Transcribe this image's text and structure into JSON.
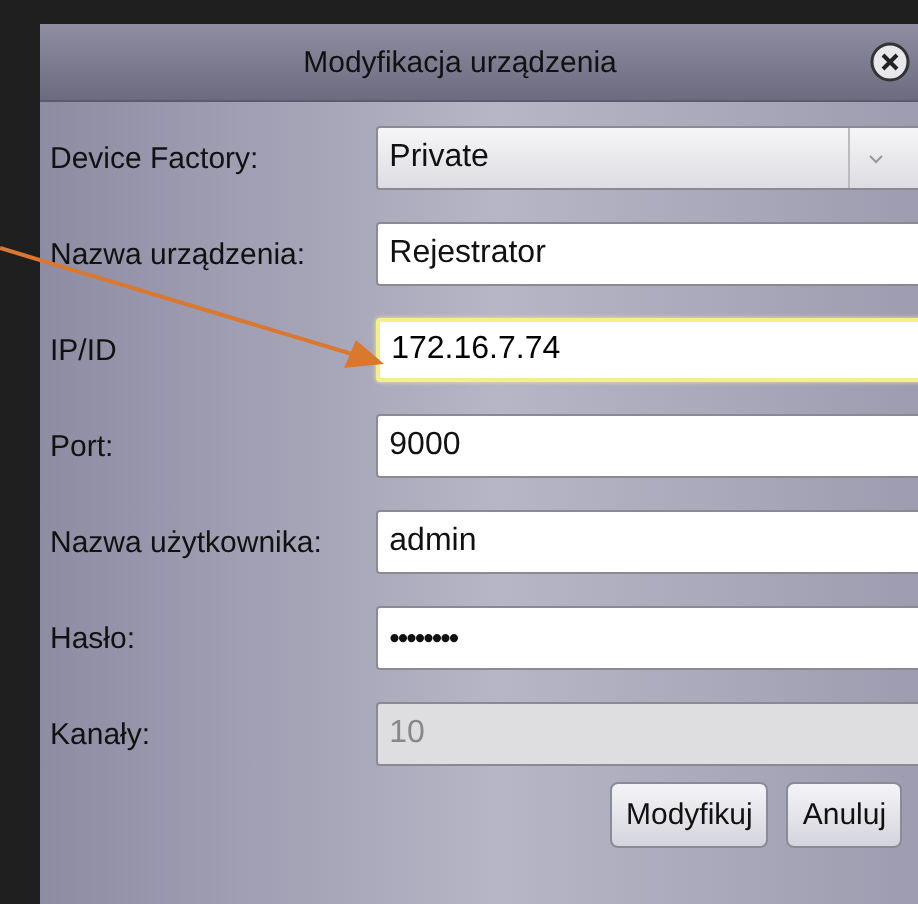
{
  "window": {
    "title": "Modyfikacja urządzenia"
  },
  "fields": [
    {
      "label": "Device Factory:",
      "kind": "dropdown",
      "value": "Private",
      "focused": false,
      "disabled": false
    },
    {
      "label": "Nazwa urządzenia:",
      "kind": "text",
      "value": "Rejestrator",
      "focused": false,
      "disabled": false
    },
    {
      "label": "IP/ID",
      "kind": "text",
      "value": "172.16.7.74",
      "focused": true,
      "disabled": false
    },
    {
      "label": "Port:",
      "kind": "text",
      "value": "9000",
      "focused": false,
      "disabled": false
    },
    {
      "label": "Nazwa użytkownika:",
      "kind": "text",
      "value": "admin",
      "focused": false,
      "disabled": false
    },
    {
      "label": "Hasło:",
      "kind": "password",
      "value": "••••••••",
      "focused": false,
      "disabled": false
    },
    {
      "label": "Kanały:",
      "kind": "text",
      "value": "10",
      "focused": false,
      "disabled": true
    }
  ],
  "buttons": [
    "Modyfikuj",
    "Anuluj"
  ]
}
